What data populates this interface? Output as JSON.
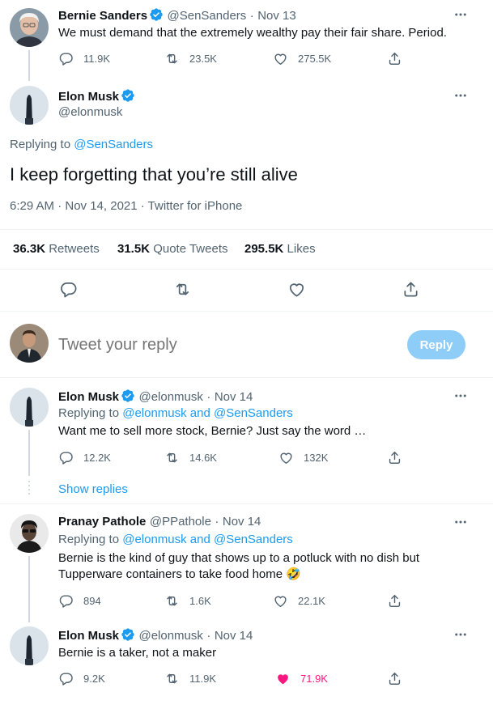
{
  "original_tweet": {
    "name": "Bernie Sanders",
    "handle": "@SenSanders",
    "date": "Nov 13",
    "text": "We must demand that the extremely wealthy pay their fair share. Period.",
    "replies": "11.9K",
    "retweets": "23.5K",
    "likes": "275.5K"
  },
  "main_tweet": {
    "name": "Elon Musk",
    "handle": "@elonmusk",
    "replying_label": "Replying to",
    "replying_to": "@SenSanders",
    "text": "I keep forgetting that you’re still alive",
    "timestamp": "6:29 AM · Nov 14, 2021 · Twitter for iPhone",
    "retweets_count": "36.3K",
    "retweets_label": "Retweets",
    "quotes_count": "31.5K",
    "quotes_label": "Quote Tweets",
    "likes_count": "295.5K",
    "likes_label": "Likes"
  },
  "composer": {
    "placeholder": "Tweet your reply",
    "button_label": "Reply"
  },
  "replies": [
    {
      "name": "Elon Musk",
      "handle": "@elonmusk",
      "date": "Nov 14",
      "replying_label": "Replying to",
      "replying_to": "@elonmusk and @SenSanders",
      "text": "Want me to sell more stock, Bernie? Just say the word …",
      "replies": "12.2K",
      "retweets": "14.6K",
      "likes": "132K"
    },
    {
      "name": "Pranay Pathole",
      "handle": "@PPathole",
      "date": "Nov 14",
      "replying_label": "Replying to",
      "replying_to": "@elonmusk and @SenSanders",
      "text_line1": "Bernie is the kind of guy that shows up to a potluck with no dish but",
      "text_line2": "Tupperware containers to take food home 🤣",
      "replies": "894",
      "retweets": "1.6K",
      "likes": "22.1K"
    },
    {
      "name": "Elon Musk",
      "handle": "@elonmusk",
      "date": "Nov 14",
      "text": "Bernie is a taker, not a maker",
      "replies": "9.2K",
      "retweets": "11.9K",
      "likes": "71.9K"
    }
  ],
  "show_replies_label": "Show replies",
  "separator": "·",
  "colors": {
    "accent": "#1d9bf0",
    "like": "#f91880",
    "text": "#0f1419",
    "secondary": "#536471"
  },
  "icons": [
    "verified-icon",
    "more-icon",
    "reply-icon",
    "retweet-icon",
    "like-icon",
    "share-icon"
  ]
}
